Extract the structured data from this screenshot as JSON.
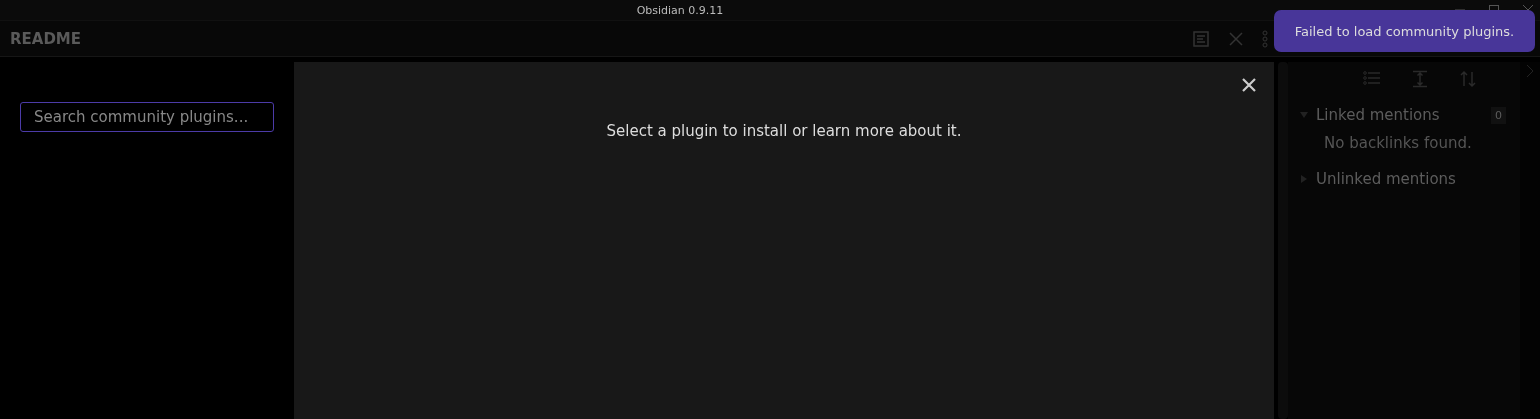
{
  "window": {
    "title": "Obsidian 0.9.11"
  },
  "pane": {
    "title": "README"
  },
  "plugin_browser": {
    "search": {
      "placeholder": "Search community plugins..."
    },
    "message": "Select a plugin to install or learn more about it."
  },
  "backlinks": {
    "sections": [
      {
        "title": "Linked mentions",
        "expanded": true,
        "count": "0",
        "empty_text": "No backlinks found."
      },
      {
        "title": "Unlinked mentions",
        "expanded": false
      }
    ]
  },
  "notice": {
    "text": "Failed to load community plugins."
  }
}
